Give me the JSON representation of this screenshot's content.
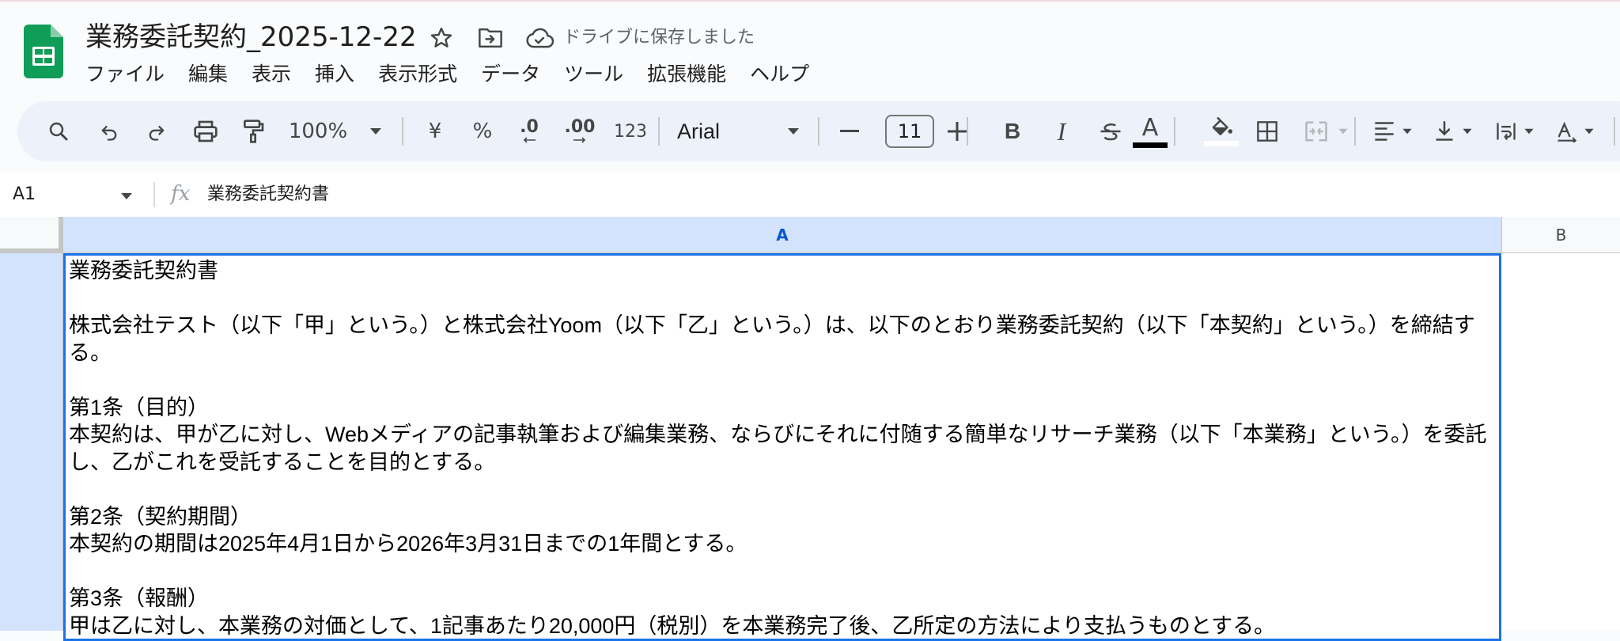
{
  "document": {
    "title": "業務委託契約_2025-12-22",
    "save_status": "ドライブに保存しました"
  },
  "menu": [
    "ファイル",
    "編集",
    "表示",
    "挿入",
    "表示形式",
    "データ",
    "ツール",
    "拡張機能",
    "ヘルプ"
  ],
  "toolbar": {
    "zoom": "100%",
    "currency": "¥",
    "percent": "%",
    "decrease_decimal": ".0",
    "increase_decimal": ".00",
    "number_format": "123",
    "font": "Arial",
    "font_size": "11",
    "bold": "B",
    "italic": "I",
    "text_color": "A",
    "text_color_value": "#000000",
    "fill_color_value": "#ffffff"
  },
  "formula_bar": {
    "cell_ref": "A1",
    "fx": "fx",
    "content": "業務委託契約書"
  },
  "grid": {
    "columns": [
      "A",
      "B"
    ],
    "selected_cell": "A1",
    "cell_a1": "業務委託契約書\n\n株式会社テスト（以下「甲」という。）と株式会社Yoom（以下「乙」という。）は、以下のとおり業務委託契約（以下「本契約」という。）を締結する。\n\n第1条（目的）\n本契約は、甲が乙に対し、Webメディアの記事執筆および編集業務、ならびにそれに付随する簡単なリサーチ業務（以下「本業務」という。）を委託し、乙がこれを受託することを目的とする。\n\n第2条（契約期間）\n本契約の期間は2025年4月1日から2026年3月31日までの1年間とする。\n\n第3条（報酬）\n甲は乙に対し、本業務の対価として、1記事あたり20,000円（税別）を本業務完了後、乙所定の方法により支払うものとする。"
  }
}
